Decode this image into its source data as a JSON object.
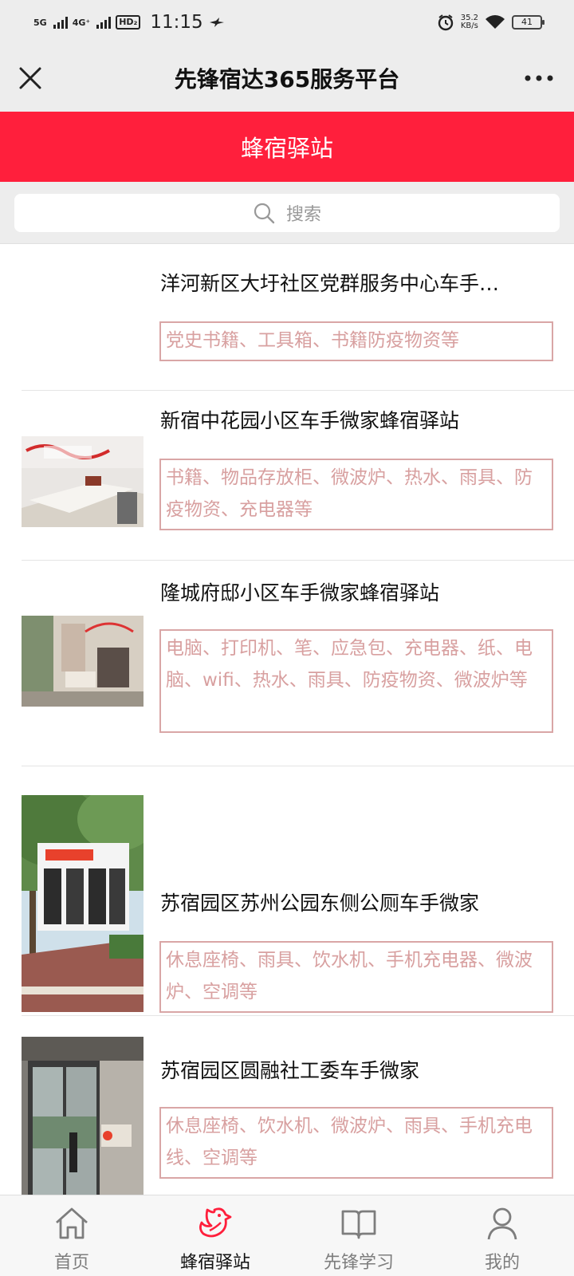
{
  "status": {
    "network1": "5G",
    "network2": "4G⁺",
    "hd": "HD₂",
    "time": "11:15",
    "speed_value": "35.2",
    "speed_unit": "KB/s",
    "battery": "41"
  },
  "titlebar": {
    "title": "先锋宿达365服务平台"
  },
  "banner": {
    "title": "蜂宿驿站"
  },
  "search": {
    "placeholder": "搜索"
  },
  "list": {
    "items": [
      {
        "name": "洋河新区大圩社区党群服务中心车手…",
        "tags": "党史书籍、工具箱、书籍防疫物资等"
      },
      {
        "name": "新宿中花园小区车手微家蜂宿驿站",
        "tags": "书籍、物品存放柜、微波炉、热水、雨具、防疫物资、充电器等"
      },
      {
        "name": "隆城府邸小区车手微家蜂宿驿站",
        "tags": "电脑、打印机、笔、应急包、充电器、纸、电脑、wifi、热水、雨具、防疫物资、微波炉等"
      },
      {
        "name": "苏宿园区苏州公园东侧公厕车手微家",
        "tags": "休息座椅、雨具、饮水机、手机充电器、微波炉、空调等"
      },
      {
        "name": "苏宿园区圆融社工委车手微家",
        "tags": "休息座椅、饮水机、微波炉、雨具、手机充电线、空调等"
      }
    ]
  },
  "nav": {
    "tabs": [
      {
        "label": "首页",
        "icon": "home-icon"
      },
      {
        "label": "蜂宿驿站",
        "icon": "bird-icon"
      },
      {
        "label": "先锋学习",
        "icon": "book-icon"
      },
      {
        "label": "我的",
        "icon": "person-icon"
      }
    ],
    "active_tab": "蜂宿驿站",
    "active_color": "#ff1f3c"
  },
  "colors": {
    "banner": "#ff1f3c",
    "tag_border": "#d9a6a6",
    "tag_text": "#d8a0a0"
  }
}
